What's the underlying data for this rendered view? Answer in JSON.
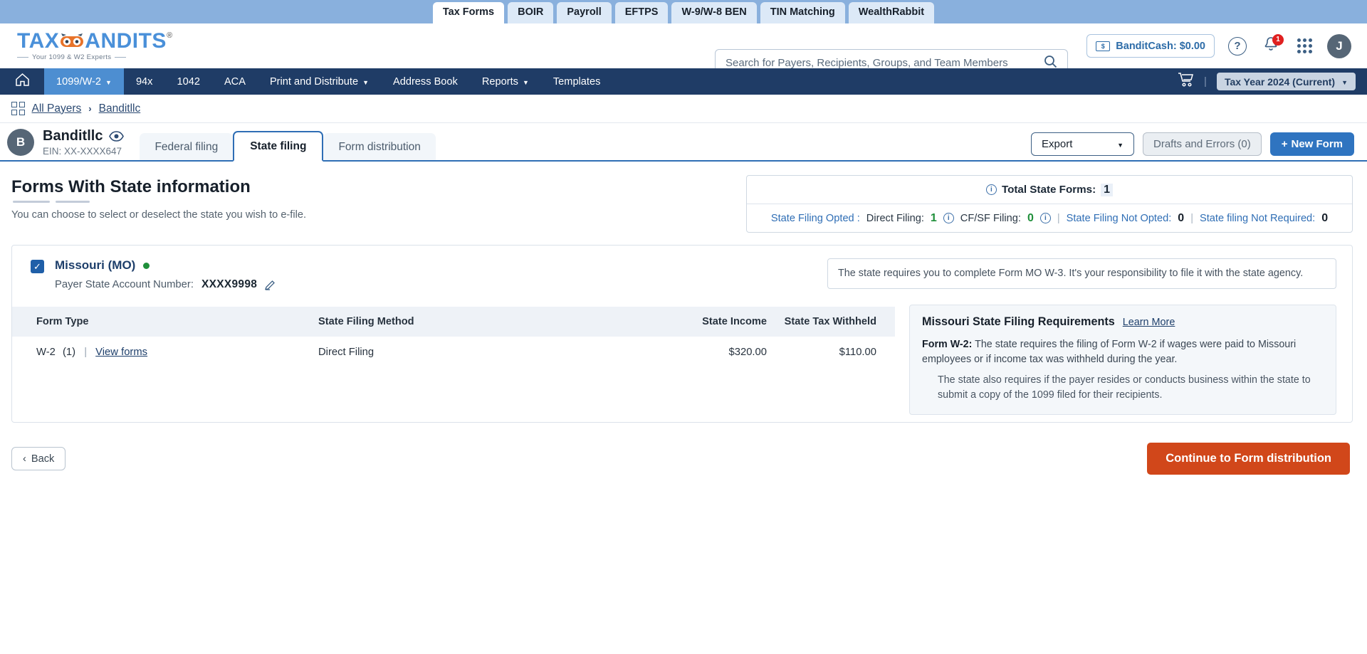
{
  "product_tabs": [
    {
      "label": "Tax Forms",
      "active": true
    },
    {
      "label": "BOIR",
      "active": false
    },
    {
      "label": "Payroll",
      "active": false
    },
    {
      "label": "EFTPS",
      "active": false
    },
    {
      "label": "W-9/W-8 BEN",
      "active": false
    },
    {
      "label": "TIN Matching",
      "active": false
    },
    {
      "label": "WealthRabbit",
      "active": false
    }
  ],
  "brand": {
    "name_part1": "TAX",
    "name_part2": "ANDITS",
    "registered": "®",
    "tagline": "Your 1099 & W2 Experts",
    "accent": "#4a90d9"
  },
  "search": {
    "placeholder": "Search for Payers, Recipients, Groups, and Team Members",
    "value": "",
    "icon": "search-icon"
  },
  "header_right": {
    "banditcash_label": "BanditCash: $0.00",
    "banditcash_icon": "money-bill-icon",
    "help_icon": "question-mark-icon",
    "bell_icon": "notification-bell-icon",
    "notification_count": "1",
    "apps_icon": "apps-grid-icon",
    "avatar_initial": "J"
  },
  "nav": {
    "home_icon": "home-icon",
    "items": [
      {
        "label": "1099/W-2",
        "caret": true,
        "active": true
      },
      {
        "label": "94x",
        "caret": false,
        "active": false
      },
      {
        "label": "1042",
        "caret": false,
        "active": false
      },
      {
        "label": "ACA",
        "caret": false,
        "active": false
      },
      {
        "label": "Print and Distribute",
        "caret": true,
        "active": false
      },
      {
        "label": "Address Book",
        "caret": false,
        "active": false
      },
      {
        "label": "Reports",
        "caret": true,
        "active": false
      },
      {
        "label": "Templates",
        "caret": false,
        "active": false
      }
    ],
    "cart_icon": "shopping-cart-icon",
    "separator": "|",
    "tax_year": "Tax Year 2024 (Current)"
  },
  "breadcrumb": {
    "grid_icon": "dashboard-grid-icon",
    "all_payers": "All Payers",
    "separator": "›",
    "current": "Banditllc"
  },
  "payer": {
    "avatar_initial": "B",
    "name": "Banditllc",
    "eye_icon": "eye-icon",
    "ein": "EIN: XX-XXXX647"
  },
  "tabs": [
    {
      "label": "Federal filing",
      "active": false
    },
    {
      "label": "State filing",
      "active": true
    },
    {
      "label": "Form distribution",
      "active": false
    }
  ],
  "actions": {
    "export_label": "Export",
    "export_caret_icon": "chevron-down-icon",
    "drafts_label": "Drafts and Errors (0)",
    "new_form_label": "New  Form",
    "new_form_plus": "+"
  },
  "page": {
    "title": "Forms With State information",
    "subtitle": "You can choose to select or deselect the state you wish to e-file."
  },
  "summary": {
    "info_icon": "info-icon",
    "total_label": "Total State Forms:",
    "total_value": "1",
    "state_filing_opted_label": "State Filing Opted :",
    "direct_filing_label": "Direct Filing:",
    "direct_filing_value": "1",
    "cfsf_label": "CF/SF Filing:",
    "cfsf_value": "0",
    "not_opted_label": "State Filing Not Opted:",
    "not_opted_value": "0",
    "not_required_label": "State filing Not Required:",
    "not_required_value": "0",
    "separator": "|"
  },
  "state": {
    "checkbox_checked": true,
    "check_glyph": "✓",
    "name": "Missouri (MO)",
    "status_dot_color": "#1f8f3a",
    "account_label": "Payer State Account Number:",
    "account_value": "XXXX9998",
    "edit_icon": "pencil-edit-icon",
    "notice": "The state requires you to complete Form MO W-3. It's your responsibility to file it with the state agency."
  },
  "table": {
    "columns": [
      "Form Type",
      "State Filing Method",
      "State Income",
      "State Tax Withheld"
    ],
    "rows": [
      {
        "form_type": "W-2",
        "form_count": "(1)",
        "pipe": "|",
        "view_link": "View forms",
        "method": "Direct Filing",
        "income": "$320.00",
        "withheld": "$110.00"
      }
    ]
  },
  "requirements": {
    "title": "Missouri State Filing Requirements",
    "learn_more": "Learn More",
    "form_label": "Form W-2:",
    "paragraph1": "The state requires the filing of Form W-2 if wages were paid to Missouri employees or if income tax was withheld during the year.",
    "paragraph2": "The state also requires if the payer resides or conducts business within the state to submit a copy of the 1099 filed for their recipients."
  },
  "footer": {
    "back_label": "Back",
    "back_icon": "chevron-left-icon",
    "continue_label": "Continue to Form distribution",
    "continue_color": "#d1471a"
  }
}
